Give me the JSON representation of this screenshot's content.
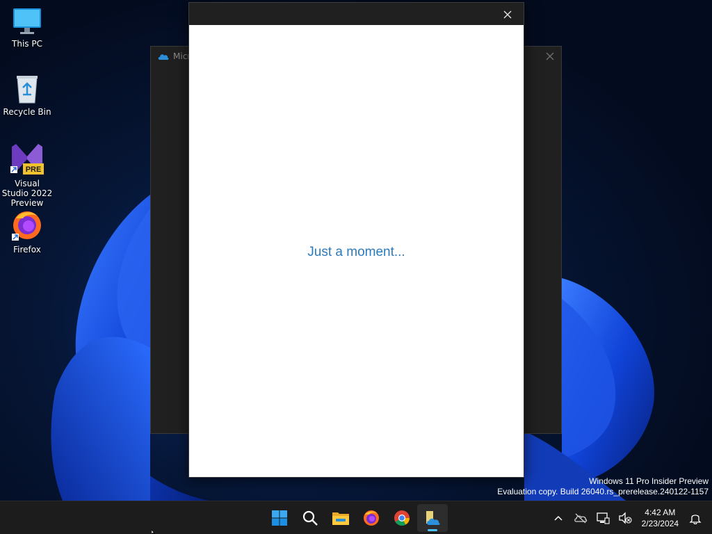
{
  "desktop": {
    "icons": [
      {
        "label": "This PC",
        "icon": "monitor-icon"
      },
      {
        "label": "Recycle Bin",
        "icon": "recycle-bin-icon"
      },
      {
        "label": "Visual Studio 2022 Preview",
        "icon": "visual-studio-icon",
        "badge": "PRE"
      },
      {
        "label": "Firefox",
        "icon": "firefox-icon"
      }
    ]
  },
  "background_window": {
    "title": "Micro",
    "icon": "onedrive-icon"
  },
  "dialog": {
    "message": "Just a moment..."
  },
  "watermark": {
    "line1": "Windows 11 Pro Insider Preview",
    "line2": "Evaluation copy. Build 26040.rs_prerelease.240122-1157"
  },
  "taskbar": {
    "apps": [
      {
        "name": "Start",
        "icon": "windows-start-icon"
      },
      {
        "name": "Search",
        "icon": "search-icon"
      },
      {
        "name": "File Explorer",
        "icon": "folder-icon"
      },
      {
        "name": "Firefox",
        "icon": "firefox-icon"
      },
      {
        "name": "Chrome",
        "icon": "chrome-icon"
      },
      {
        "name": "OneDrive Setup",
        "icon": "onedrive-setup-icon",
        "active": true
      }
    ],
    "clock": {
      "time": "4:42 AM",
      "date": "2/23/2024"
    }
  },
  "colors": {
    "accent": "#4cc2ff",
    "message": "#2b7bbf",
    "taskbar": "#1c1c1c"
  }
}
